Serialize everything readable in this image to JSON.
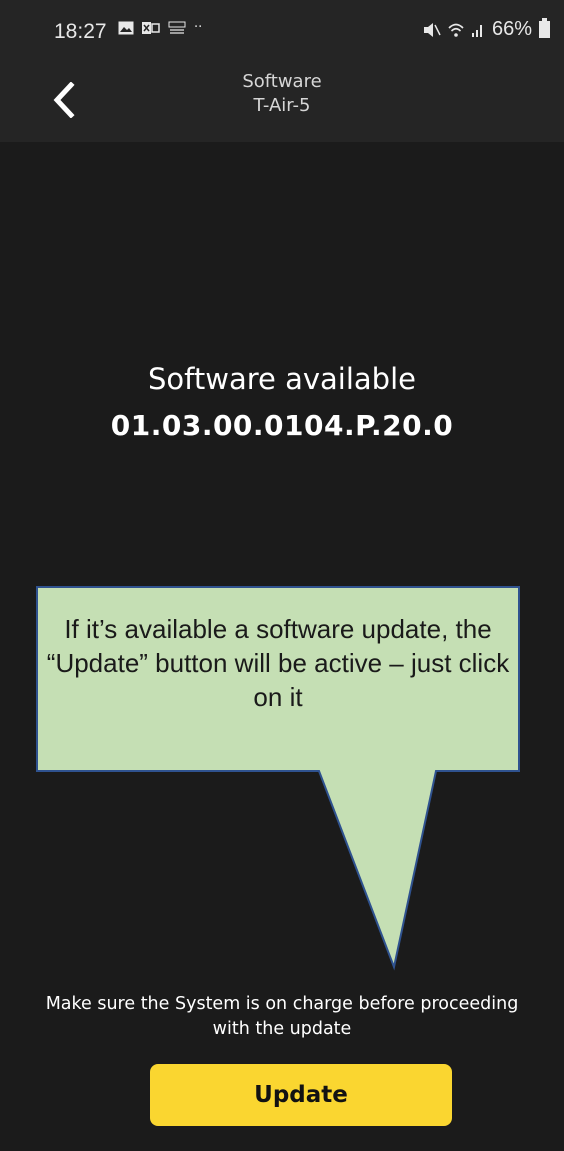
{
  "status_bar": {
    "time": "18:27",
    "battery": "66%",
    "icons_left": [
      "gallery-icon",
      "notification-icon",
      "tech-icon",
      "more-dots-icon"
    ],
    "icons_right": [
      "mute-icon",
      "wifi-icon",
      "signal-icon",
      "battery-icon"
    ],
    "more_dots": "··"
  },
  "header": {
    "title": "Software",
    "subtitle": "T-Air-5"
  },
  "main": {
    "available_label": "Software available",
    "version": "01.03.00.0104.P.20.0",
    "charge_note": "Make sure the System is on charge before proceeding with the update",
    "update_label": "Update"
  },
  "callout": {
    "text": "If it’s available a software update, the “Update” button will be active – just click on it",
    "fill_color": "#c5dfb4",
    "border_color": "#2f528f"
  },
  "colors": {
    "background": "#1b1b1b",
    "header_bg": "#252525",
    "accent": "#fad630"
  }
}
